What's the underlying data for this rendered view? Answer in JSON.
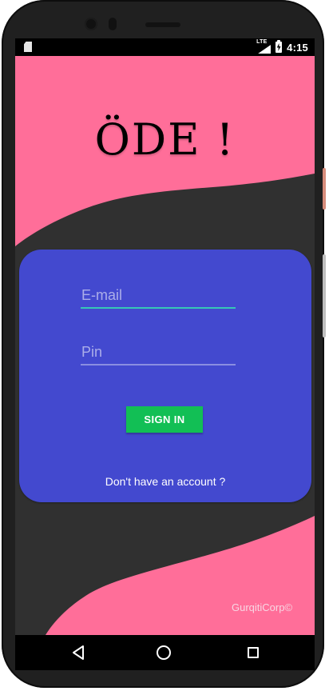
{
  "status_bar": {
    "time": "4:15",
    "network": "LTE",
    "icons": [
      "sd-card-icon",
      "lte-signal-icon",
      "battery-charging-icon"
    ]
  },
  "app": {
    "title": "ÖDE !",
    "email_placeholder": "E-mail",
    "email_value": "",
    "pin_placeholder": "Pin",
    "pin_value": "",
    "signin_label": "SIGN IN",
    "signup_prompt": "Don't have an account ?",
    "footer": "GurqitiCorp©"
  },
  "colors": {
    "pink": "#ff6e99",
    "dark_bg": "#303030",
    "card_blue": "#4349cf",
    "signin_green": "#12bf55",
    "field_accent": "#37c7b6",
    "footer_text": "#f8d6e3"
  },
  "navigation": {
    "buttons": [
      "back-icon",
      "home-icon",
      "recent-apps-icon"
    ]
  }
}
